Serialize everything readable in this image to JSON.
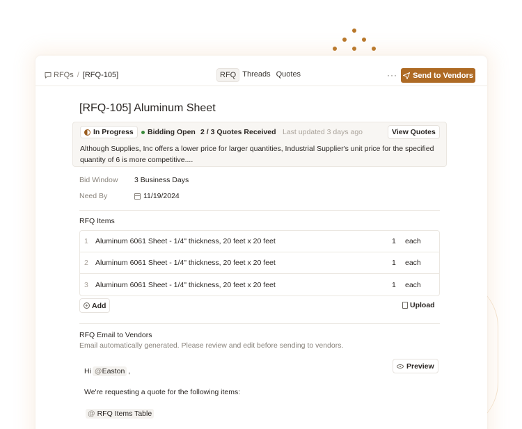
{
  "breadcrumb": {
    "root": "RFQs",
    "separator": "/",
    "current": "[RFQ-105]"
  },
  "tabs": [
    {
      "label": "RFQ",
      "active": true
    },
    {
      "label": "Threads",
      "active": false
    },
    {
      "label": "Quotes",
      "active": false
    }
  ],
  "toolbar": {
    "more_label": "···",
    "send_label": "Send to Vendors"
  },
  "rfq": {
    "title": "[RFQ-105]  Aluminum Sheet"
  },
  "status": {
    "progress": "In Progress",
    "bidding": "Bidding Open",
    "quotes_received": "2 / 3 Quotes Received",
    "last_updated": "Last updated 3 days ago",
    "view_quotes": "View Quotes",
    "summary": "Although Supplies, Inc offers a lower price for larger quantities, Industrial Supplier's unit price for the specified quantity of 6 is more competitive...."
  },
  "meta": {
    "bid_window_label": "Bid Window",
    "bid_window_value": "3 Business Days",
    "need_by_label": "Need By",
    "need_by_value": "11/19/2024"
  },
  "items": {
    "title": "RFQ Items",
    "rows": [
      {
        "num": "1",
        "desc": "Aluminum 6061 Sheet - 1/4\" thickness, 20 feet x 20 feet",
        "qty": "1",
        "unit": "each"
      },
      {
        "num": "2",
        "desc": "Aluminum 6061 Sheet - 1/4\" thickness, 20 feet x 20 feet",
        "qty": "1",
        "unit": "each"
      },
      {
        "num": "3",
        "desc": "Aluminum 6061 Sheet - 1/4\" thickness, 20 feet x 20 feet",
        "qty": "1",
        "unit": "each"
      }
    ],
    "add_label": "Add",
    "upload_label": "Upload"
  },
  "email": {
    "title": "RFQ Email to Vendors",
    "subtitle": "Email automatically generated. Please review and edit before sending to vendors.",
    "preview_label": "Preview",
    "greeting_prefix": "Hi",
    "mention_name": "Easton",
    "greeting_suffix": ",",
    "body_line": "We're requesting a quote for the following items:",
    "table_mention": "RFQ Items Table"
  },
  "colors": {
    "accent": "#ae6a24",
    "status_green": "#3a8a3a"
  }
}
